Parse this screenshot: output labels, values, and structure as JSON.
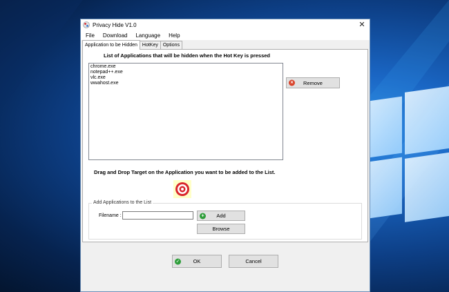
{
  "window": {
    "title": "Privacy Hide V1.0",
    "close_glyph": "✕"
  },
  "menu": [
    {
      "label": "File"
    },
    {
      "label": "Download"
    },
    {
      "label": "Language"
    },
    {
      "label": "Help"
    }
  ],
  "tabs": [
    {
      "label": "Application to be Hidden",
      "active": true
    },
    {
      "label": "HotKey",
      "active": false
    },
    {
      "label": "Options",
      "active": false
    }
  ],
  "list": {
    "heading": "List of Applications that will be hidden when the Hot Key is pressed",
    "items": [
      "chrome.exe",
      "notepad++.exe",
      "vlc.exe",
      "wwahost.exe"
    ]
  },
  "buttons": {
    "remove": "Remove",
    "add": "Add",
    "browse": "Browse",
    "ok": "OK",
    "cancel": "Cancel"
  },
  "drag": {
    "heading": "Drag and Drop Target on the Application you want to be added to the List."
  },
  "add_group": {
    "title": "Add Applications to the List",
    "filename_label": "Filename :",
    "filename_value": ""
  },
  "colors": {
    "remove_icon": "#d9432b",
    "add_icon": "#2f9e3b",
    "ok_icon": "#2f9e3b",
    "target_red": "#d9252b"
  }
}
